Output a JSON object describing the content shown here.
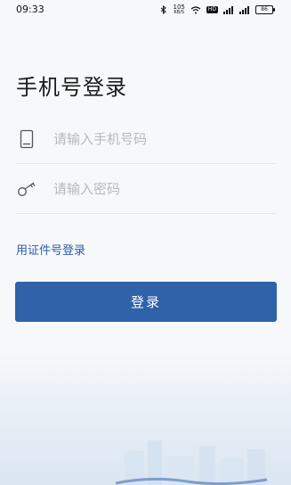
{
  "status_bar": {
    "time": "09:33",
    "network_speed": "105",
    "network_unit": "KB/S",
    "wifi_badge": "HD",
    "battery": "86"
  },
  "page": {
    "title": "手机号登录"
  },
  "form": {
    "phone_placeholder": "请输入手机号码",
    "password_placeholder": "请输入密码"
  },
  "links": {
    "alt_login": "用证件号登录"
  },
  "buttons": {
    "login": "登录"
  },
  "colors": {
    "accent": "#2f62a8",
    "link": "#2e5ea8",
    "divider": "#e6e6e6"
  }
}
